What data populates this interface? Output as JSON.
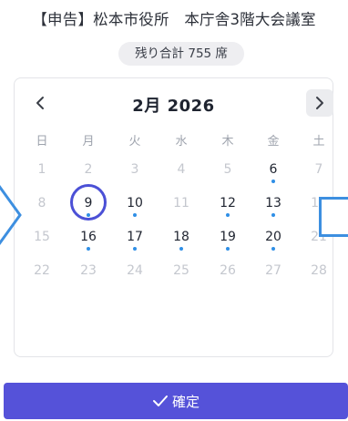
{
  "header": {
    "title": "【申告】松本市役所　本庁舎3階大会議室",
    "remaining": "残り合計 755 席"
  },
  "calendar": {
    "month_label": "2月 2026",
    "weekdays": [
      "日",
      "月",
      "火",
      "水",
      "木",
      "金",
      "土"
    ],
    "weeks": [
      [
        {
          "d": "1",
          "s": "dim"
        },
        {
          "d": "2",
          "s": "dim"
        },
        {
          "d": "3",
          "s": "dim"
        },
        {
          "d": "4",
          "s": "dim"
        },
        {
          "d": "5",
          "s": "dim"
        },
        {
          "d": "6",
          "s": "avail"
        },
        {
          "d": "7",
          "s": "dim"
        }
      ],
      [
        {
          "d": "8",
          "s": "dim"
        },
        {
          "d": "9",
          "s": "selected"
        },
        {
          "d": "10",
          "s": "avail"
        },
        {
          "d": "11",
          "s": "dim"
        },
        {
          "d": "12",
          "s": "avail"
        },
        {
          "d": "13",
          "s": "avail"
        },
        {
          "d": "14",
          "s": "dim"
        }
      ],
      [
        {
          "d": "15",
          "s": "dim"
        },
        {
          "d": "16",
          "s": "avail"
        },
        {
          "d": "17",
          "s": "avail"
        },
        {
          "d": "18",
          "s": "avail"
        },
        {
          "d": "19",
          "s": "avail"
        },
        {
          "d": "20",
          "s": "avail"
        },
        {
          "d": "21",
          "s": "dim"
        }
      ],
      [
        {
          "d": "22",
          "s": "dim"
        },
        {
          "d": "23",
          "s": "dim"
        },
        {
          "d": "24",
          "s": "dim"
        },
        {
          "d": "25",
          "s": "dim"
        },
        {
          "d": "26",
          "s": "dim"
        },
        {
          "d": "27",
          "s": "dim"
        },
        {
          "d": "28",
          "s": "dim"
        }
      ]
    ]
  },
  "footer": {
    "confirm_label": "確定"
  },
  "colors": {
    "accent": "#5552d9",
    "selected_ring": "#4b50d6",
    "availability_dot": "#2f8fe6",
    "side_arrow": "#3d8fe0"
  }
}
